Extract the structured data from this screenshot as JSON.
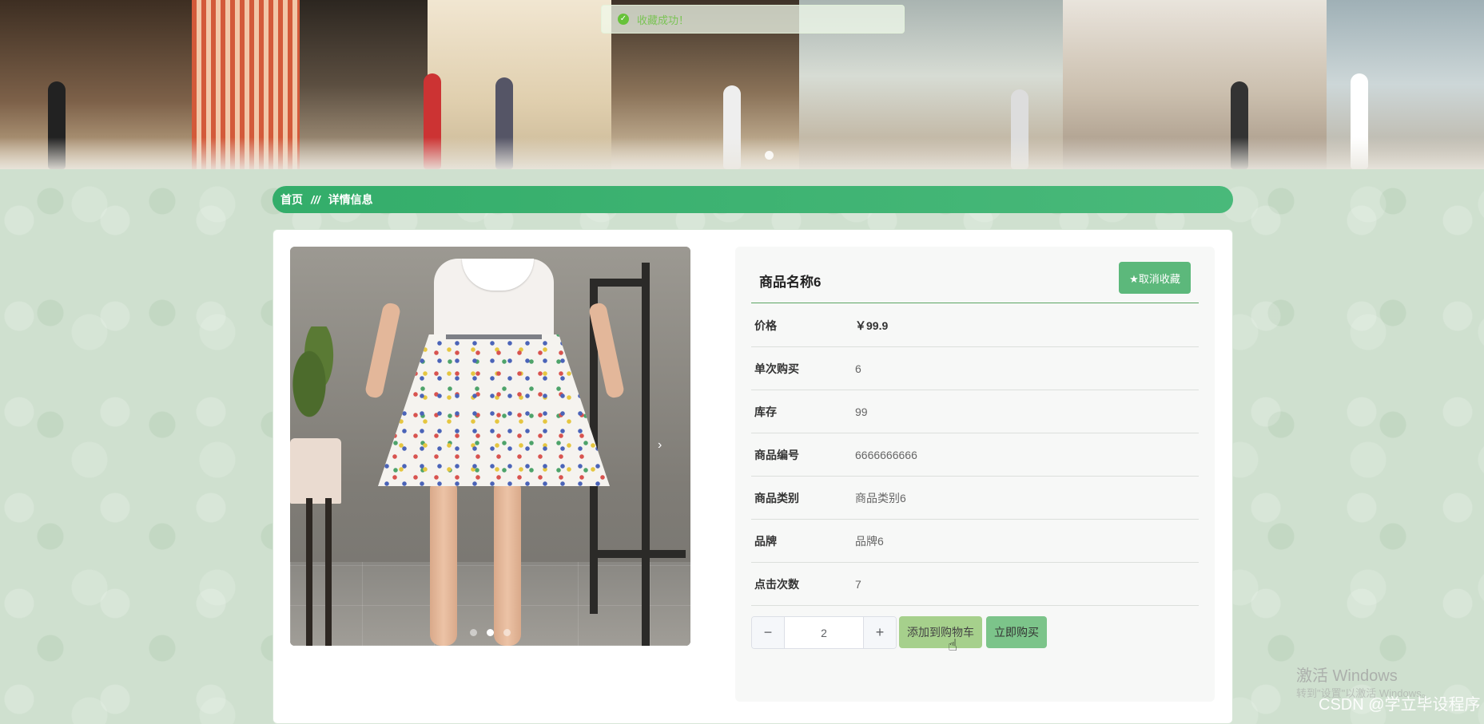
{
  "toast": {
    "text": "收藏成功！"
  },
  "breadcrumb": {
    "home": "首页",
    "separator": "///",
    "current": "详情信息"
  },
  "product": {
    "name": "商品名称6",
    "favorite_button": "★取消收藏",
    "fields": [
      {
        "label": "价格",
        "value": "￥99.9"
      },
      {
        "label": "单次购买",
        "value": "6"
      },
      {
        "label": "库存",
        "value": "99"
      },
      {
        "label": "商品编号",
        "value": "6666666666"
      },
      {
        "label": "商品类别",
        "value": "商品类别6"
      },
      {
        "label": "品牌",
        "value": "品牌6"
      },
      {
        "label": "点击次数",
        "value": "7"
      }
    ],
    "quantity": "2",
    "minus": "−",
    "plus": "+",
    "add_to_cart": "添加到购物车",
    "buy_now": "立即购买"
  },
  "gallery": {
    "next_arrow": "›",
    "slides": 3,
    "active_slide": 2
  },
  "watermarks": {
    "windows": "激活 Windows",
    "windows_sub": "转到\"设置\"以激活 Windows。",
    "csdn": "CSDN @学立毕设程序"
  },
  "colors": {
    "accent": "#3aaf6e",
    "background": "#cfe0cf",
    "success": "#67c23a"
  }
}
